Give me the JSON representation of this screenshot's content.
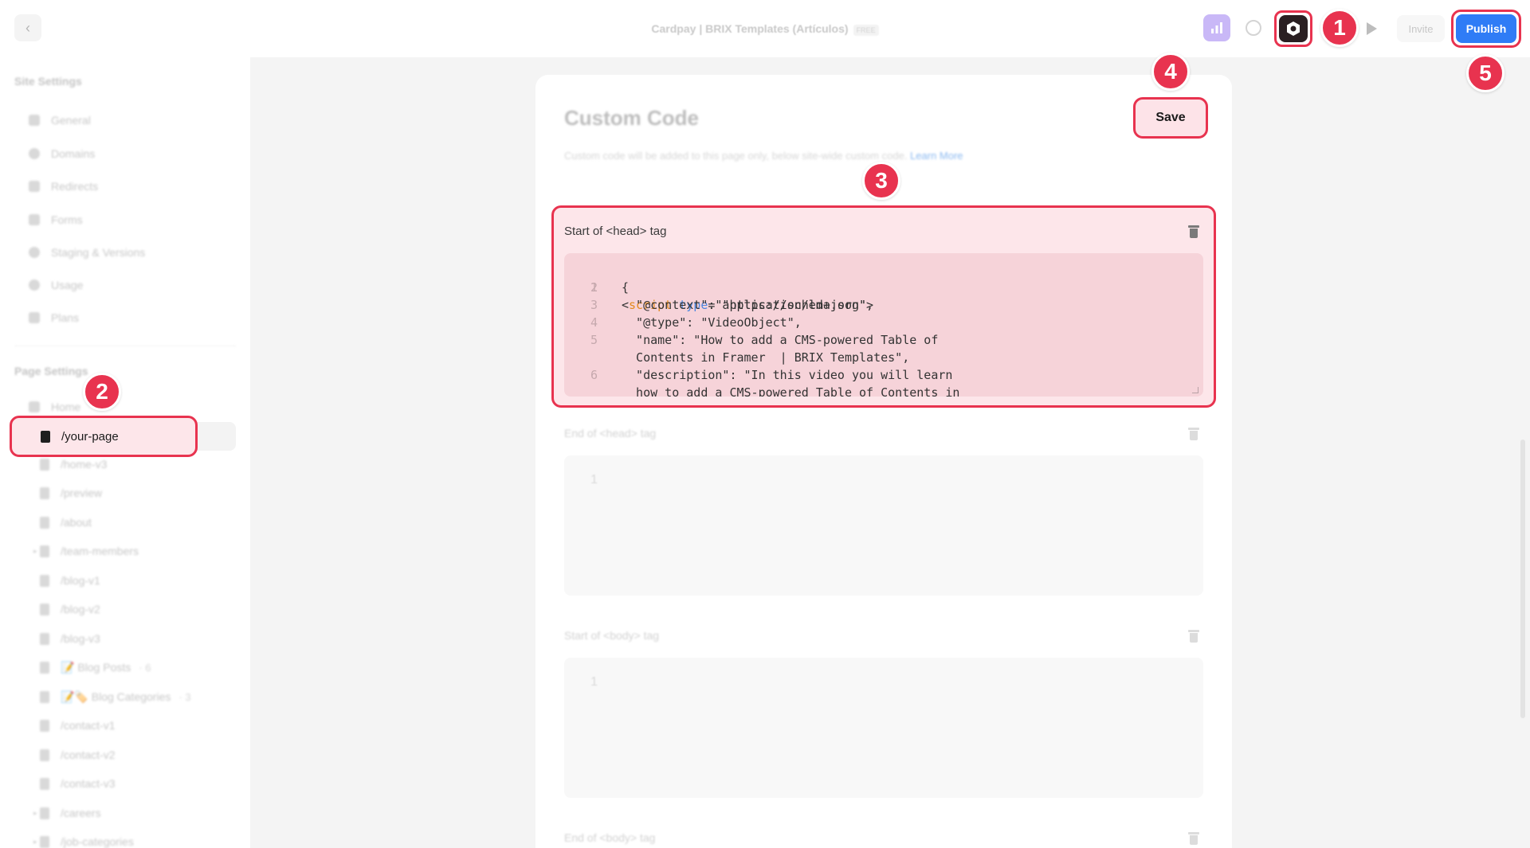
{
  "topbar": {
    "project_title": "Cardpay | BRIX Templates (Artículos)",
    "plan_badge": "FREE",
    "invite_label": "Invite",
    "publish_label": "Publish"
  },
  "badges": [
    "1",
    "2",
    "3",
    "4",
    "5"
  ],
  "sidebar": {
    "site_settings_title": "Site Settings",
    "site_items": [
      {
        "label": "General",
        "icon": "settings-icon"
      },
      {
        "label": "Domains",
        "icon": "globe-icon"
      },
      {
        "label": "Redirects",
        "icon": "redirect-icon"
      },
      {
        "label": "Forms",
        "icon": "form-icon"
      },
      {
        "label": "Staging & Versions",
        "icon": "versions-icon"
      },
      {
        "label": "Usage",
        "icon": "usage-icon"
      },
      {
        "label": "Plans",
        "icon": "plans-icon"
      }
    ],
    "page_settings_title": "Page Settings",
    "home_label": "Home",
    "active_page": "/your-page",
    "pages": [
      {
        "label": "/home-v3"
      },
      {
        "label": "/preview"
      },
      {
        "label": "/about"
      },
      {
        "label": "/team-members"
      },
      {
        "label": "/blog-v1"
      },
      {
        "label": "/blog-v2"
      },
      {
        "label": "/blog-v3"
      },
      {
        "label": "📝 Blog Posts",
        "meta": "· 6"
      },
      {
        "label": "📝🏷️ Blog Categories",
        "meta": "· 3"
      },
      {
        "label": "/contact-v1"
      },
      {
        "label": "/contact-v2"
      },
      {
        "label": "/contact-v3"
      },
      {
        "label": "/careers"
      },
      {
        "label": "/job-categories"
      }
    ]
  },
  "panel": {
    "title": "Custom Code",
    "description": "Custom code will be added to this page only, below site-wide custom code.",
    "learn_more": "Learn More",
    "save_label": "Save",
    "head_start_label": "Start of <head> tag",
    "head_end_label": "End of <head> tag",
    "body_start_label": "Start of <body> tag",
    "body_end_label": "End of <body> tag",
    "empty_line_number": "1",
    "code_lines": [
      {
        "num": "1",
        "text": ""
      },
      {
        "num": "2",
        "text": "{"
      },
      {
        "num": "3",
        "text": "  \"@context\": \"https://schema.org\","
      },
      {
        "num": "4",
        "text": "  \"@type\": \"VideoObject\","
      },
      {
        "num": "5",
        "text": "  \"name\": \"How to add a CMS-powered Table of"
      },
      {
        "num": "",
        "text": "  Contents in Framer  | BRIX Templates\","
      },
      {
        "num": "6",
        "text": "  \"description\": \"In this video you will learn"
      },
      {
        "num": "",
        "text": "  how to add a CMS-powered Table of Contents in"
      }
    ],
    "line1_tag_open": "<",
    "line1_tag": "script",
    "line1_attr": "type",
    "line1_rest": "=\"application/ld+json\">"
  },
  "colors": {
    "accent_red": "#e8334f",
    "publish_blue": "#2f7cf6",
    "highlight_pink": "#fde6ea"
  }
}
